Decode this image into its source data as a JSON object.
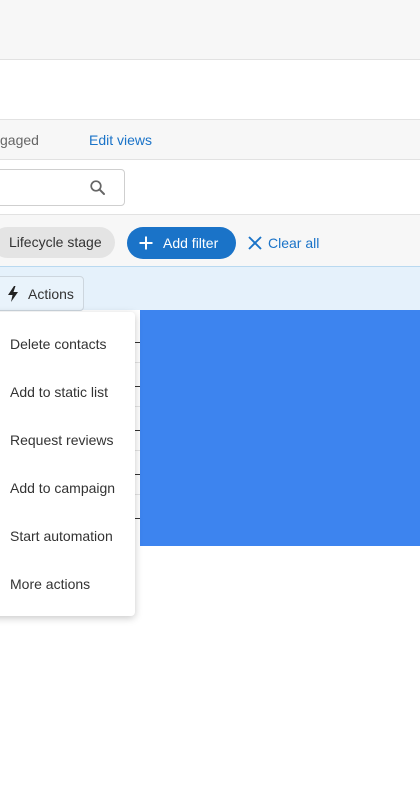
{
  "tabs": {
    "engaged_label": "gaged",
    "edit_views_label": "Edit views"
  },
  "search": {
    "value": "",
    "placeholder": "",
    "icon": "search-icon"
  },
  "filters": {
    "lifecycle_chip": "Lifecycle stage",
    "add_filter_label": "Add filter",
    "clear_all_label": "Clear all"
  },
  "toolbar": {
    "actions_label": "Actions",
    "actions_icon": "bolt-icon"
  },
  "actions_menu": {
    "items": [
      {
        "label": "Delete contacts"
      },
      {
        "label": "Add to static list"
      },
      {
        "label": "Request reviews"
      },
      {
        "label": "Add to campaign"
      },
      {
        "label": "Start automation"
      },
      {
        "label": "More actions"
      }
    ]
  },
  "colors": {
    "accent": "#1a73c8",
    "selection_panel": "#3d84ef",
    "actions_bar": "#e5f1fb",
    "chip": "#e4e4e4"
  }
}
